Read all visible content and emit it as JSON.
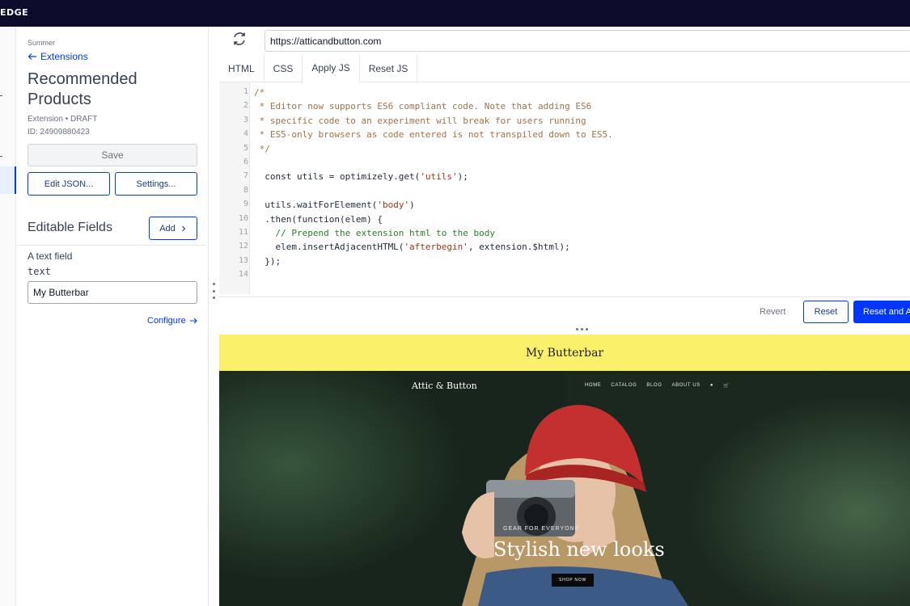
{
  "app": {
    "brand": "EDGE"
  },
  "panel": {
    "context": "Summer",
    "back_label": "Extensions",
    "title": "Recommended Products",
    "meta_status": "Extension • DRAFT",
    "meta_id": "ID: 24909880423",
    "save_label": "Save",
    "edit_json_label": "Edit JSON...",
    "settings_label": "Settings...",
    "editable_fields_title": "Editable Fields",
    "add_label": "Add",
    "field": {
      "label": "A text field",
      "key": "text",
      "value": "My Butterbar"
    },
    "configure_label": "Configure"
  },
  "browser": {
    "url": "https://atticandbutton.com"
  },
  "tabs": [
    {
      "label": "HTML"
    },
    {
      "label": "CSS"
    },
    {
      "label": "Apply JS"
    },
    {
      "label": "Reset JS"
    }
  ],
  "active_tab": "Apply JS",
  "code_lines": [
    "/*",
    " * Editor now supports ES6 compliant code. Note that adding ES6",
    " * specific code to an experiment will break for users running",
    " * ES5-only browsers as code entered is not transpiled down to ES5.",
    " */",
    "",
    "  const utils = optimizely.get('utils');",
    "",
    "  utils.waitForElement('body')",
    "  .then(function(elem) {",
    "    // Prepend the extension html to the body",
    "    elem.insertAdjacentHTML('afterbegin', extension.$html);",
    "  });",
    ""
  ],
  "actions": {
    "revert_label": "Revert",
    "reset_label": "Reset",
    "apply_label": "Reset and A"
  },
  "preview": {
    "butterbar_text": "My Butterbar",
    "shop_logo": "Attic & Button",
    "nav": [
      "HOME",
      "CATALOG",
      "BLOG",
      "ABOUT US"
    ],
    "hero_kicker": "GEAR FOR EVERYONE",
    "hero_title": "Stylish new looks",
    "cta": "SHOP NOW"
  },
  "colors": {
    "topbar": "#0b0c2c",
    "accent": "#0037ff",
    "butterbar": "#fbf06a"
  }
}
